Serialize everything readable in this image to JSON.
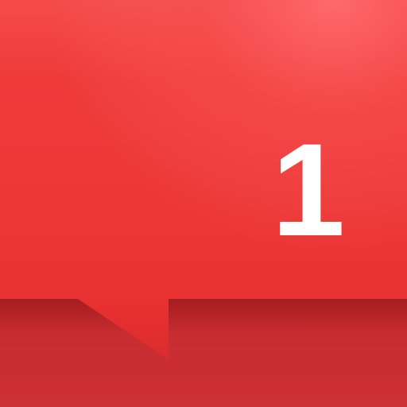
{
  "notification": {
    "count": "1"
  },
  "colors": {
    "bubble_top": "#f8575a",
    "bubble_main": "#ea3433",
    "bottom_band": "#c72d31",
    "count_text": "#ffffff"
  },
  "icons": {
    "bubble": "speech-bubble-icon"
  }
}
